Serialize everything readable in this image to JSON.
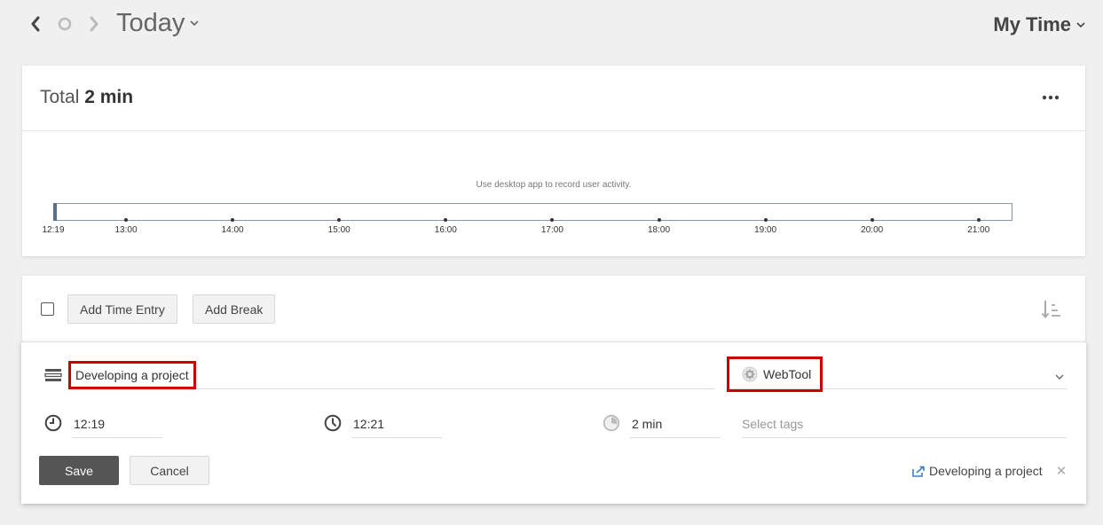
{
  "nav": {
    "period_label": "Today",
    "view_label": "My Time"
  },
  "summary": {
    "total_prefix": "Total",
    "total_value": "2 min"
  },
  "timeline": {
    "message": "Use desktop app to record user activity.",
    "ticks": [
      "12:19",
      "13:00",
      "14:00",
      "15:00",
      "16:00",
      "17:00",
      "18:00",
      "19:00",
      "20:00",
      "21:00"
    ]
  },
  "toolbar": {
    "add_time_entry": "Add Time Entry",
    "add_break": "Add Break"
  },
  "editor": {
    "description": "Developing a project",
    "project": "WebTool",
    "start_time": "12:19",
    "end_time": "12:21",
    "duration": "2 min",
    "tags_placeholder": "Select tags",
    "save_label": "Save",
    "cancel_label": "Cancel",
    "linked_item": "Developing a project"
  },
  "colors": {
    "highlight": "#cc0000",
    "save_button": "#555555",
    "link_icon": "#3d7fc4"
  }
}
